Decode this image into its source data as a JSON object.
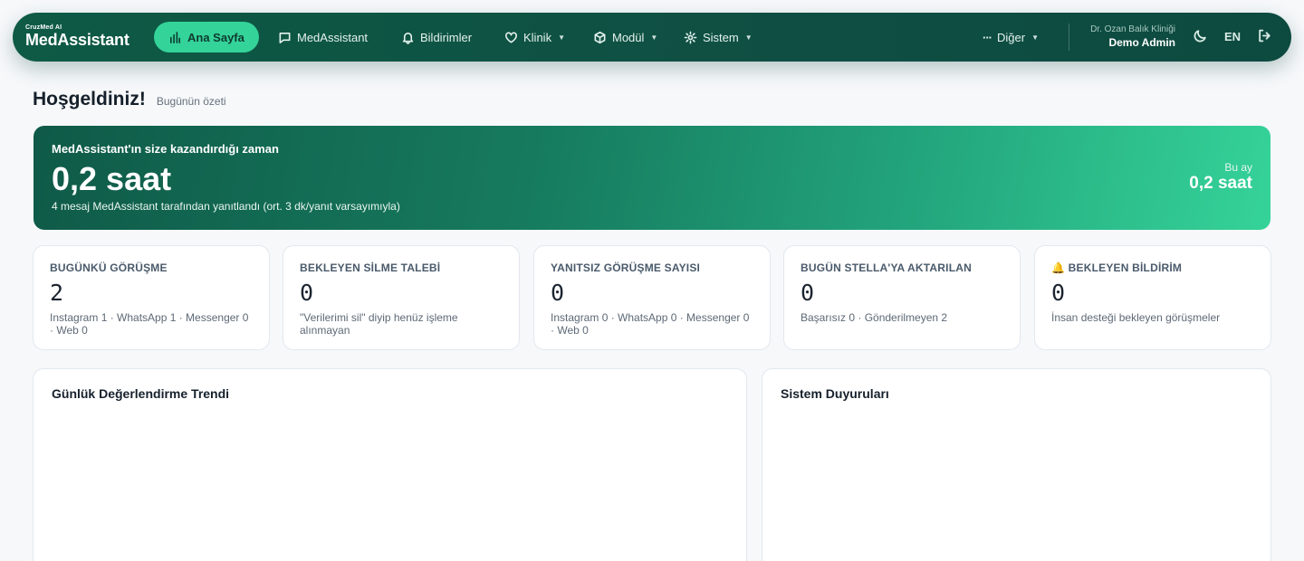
{
  "brand": {
    "tagline": "CruzMed AI",
    "name": "MedAssistant"
  },
  "nav": {
    "items": [
      {
        "label": "Ana Sayfa",
        "icon": "bar-chart-icon",
        "active": true
      },
      {
        "label": "MedAssistant",
        "icon": "chat-icon"
      },
      {
        "label": "Bildirimler",
        "icon": "bell-icon"
      },
      {
        "label": "Klinik",
        "icon": "heart-icon",
        "dropdown": true
      },
      {
        "label": "Modül",
        "icon": "cube-icon",
        "dropdown": true
      },
      {
        "label": "Sistem",
        "icon": "gear-icon",
        "dropdown": true
      }
    ],
    "more": {
      "label": "Diğer",
      "icon": "ellipsis-icon"
    },
    "user": {
      "clinic": "Dr. Ozan Balık Kliniği",
      "name": "Demo Admin"
    },
    "theme_icon": "moon-icon",
    "language": "EN",
    "logout_icon": "logout-icon"
  },
  "header": {
    "title": "Hoşgeldiniz!",
    "subtitle": "Bugünün özeti"
  },
  "hero": {
    "label": "MedAssistant'ın size kazandırdığı zaman",
    "value": "0,2 saat",
    "note": "4 mesaj MedAssistant tarafından yanıtlandı (ort. 3 dk/yanıt varsayımıyla)",
    "month_label": "Bu ay",
    "month_value": "0,2 saat"
  },
  "stats": [
    {
      "title": "BUGÜNKÜ GÖRÜŞME",
      "value": "2",
      "desc": "Instagram 1 · WhatsApp 1 · Messenger 0 · Web 0"
    },
    {
      "title": "BEKLEYEN SİLME TALEBİ",
      "value": "0",
      "desc": "\"Verilerimi sil\" diyip henüz işleme alınmayan"
    },
    {
      "title": "YANITSIZ GÖRÜŞME SAYISI",
      "value": "0",
      "desc": "Instagram 0 · WhatsApp 0 · Messenger 0 · Web 0"
    },
    {
      "title": "BUGÜN STELLA'YA AKTARILAN",
      "value": "0",
      "desc": "Başarısız 0 · Gönderilmeyen 2"
    },
    {
      "title": "🔔 BEKLEYEN BİLDİRİM",
      "value": "0",
      "desc": "İnsan desteği bekleyen görüşmeler"
    }
  ],
  "panels": {
    "trend_title": "Günlük Değerlendirme Trendi",
    "announcements_title": "Sistem Duyuruları"
  },
  "colors": {
    "brand_dark": "#0f4f43",
    "accent": "#34d399"
  }
}
